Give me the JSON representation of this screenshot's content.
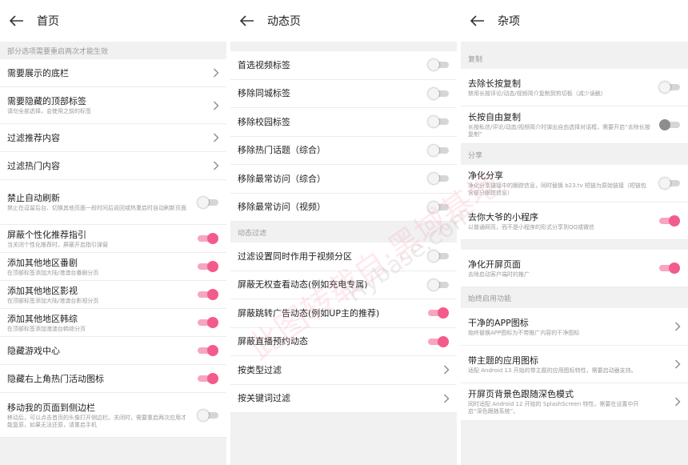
{
  "colors": {
    "accent": "#f25c8b",
    "accent_track": "#f8a5bf",
    "off_track": "#d6d6d6",
    "background": "#f1f1f1"
  },
  "icons": {
    "back": "arrow-left-icon",
    "chevron": "chevron-right-icon"
  },
  "panel1": {
    "title": "首页",
    "note": "部分选项需要重启两次才能生效",
    "items": [
      {
        "title": "需要展示的底栏",
        "type": "nav"
      },
      {
        "title": "需要隐藏的顶部标签",
        "desc": "请勿全部选择，会使用之前的标签",
        "type": "nav"
      },
      {
        "title": "过滤推荐内容",
        "type": "nav"
      },
      {
        "title": "过滤热门内容",
        "type": "nav"
      },
      {
        "title": "禁止自动刷新",
        "desc": "禁止在逗留后台、切换其他页面一段时间后返回或热重启时自动刷新页面",
        "type": "toggle",
        "on": false
      },
      {
        "title": "屏蔽个性化推荐指引",
        "desc": "当关闭个性化推荐时，屏蔽开启指引弹窗",
        "type": "toggle",
        "on": true
      },
      {
        "title": "添加其他地区番剧",
        "desc": "在顶部标签添加大陆/港澳台番剧分页",
        "type": "toggle",
        "on": true
      },
      {
        "title": "添加其他地区影视",
        "desc": "在顶部标签添加大陆/港澳台影视分页",
        "type": "toggle",
        "on": true
      },
      {
        "title": "添加其他地区韩综",
        "desc": "在顶部标签添加港澳台韩综分页",
        "type": "toggle",
        "on": true
      },
      {
        "title": "隐藏游戏中心",
        "type": "toggle",
        "on": true
      },
      {
        "title": "隐藏右上角热门活动图标",
        "type": "toggle",
        "on": true
      },
      {
        "title": "移动我的页面到侧边栏",
        "desc": "移动后，可以点击首页的头像打开侧边栏。关闭时，需要重启两次应用才能复原，如果无法还原，请重启手机",
        "type": "toggle",
        "on": false
      }
    ]
  },
  "panel2": {
    "title": "动态页",
    "groups": [
      {
        "header": "",
        "items": [
          {
            "title": "首选视频标签",
            "type": "toggle",
            "on": false
          },
          {
            "title": "移除同城标签",
            "type": "toggle",
            "on": false
          },
          {
            "title": "移除校园标签",
            "type": "toggle",
            "on": false
          },
          {
            "title": "移除热门话题（综合）",
            "type": "toggle",
            "on": false
          },
          {
            "title": "移除最常访问（综合）",
            "type": "toggle",
            "on": false
          },
          {
            "title": "移除最常访问（视频）",
            "type": "toggle",
            "on": false
          }
        ]
      },
      {
        "header": "动态过滤",
        "items": [
          {
            "title": "过滤设置同时作用于视频分区",
            "type": "toggle",
            "on": false
          },
          {
            "title": "屏蔽无权查看动态(例如充电专属)",
            "type": "toggle",
            "on": false
          },
          {
            "title": "屏蔽跳转广告动态(例如UP主的推荐)",
            "type": "toggle",
            "on": true
          },
          {
            "title": "屏蔽直播预约动态",
            "type": "toggle",
            "on": true
          },
          {
            "title": "按类型过滤",
            "type": "nav"
          },
          {
            "title": "按关键词过滤",
            "type": "nav"
          }
        ]
      }
    ]
  },
  "panel3": {
    "title": "杂项",
    "groups": [
      {
        "header": "复制",
        "items": [
          {
            "title": "去除长按复制",
            "desc": "禁用长按评论/动态/视频简介复制到剪切板（减少误触）",
            "type": "toggle",
            "on": false
          },
          {
            "title": "长按自由复制",
            "desc": "长按私信/评论/动态/视频简介时弹出自由选择对话框，需要开启“去除长按复制”",
            "type": "toggle",
            "on": false,
            "dim": true
          }
        ]
      },
      {
        "header": "分享",
        "items": [
          {
            "title": "净化分享",
            "desc": "净化分享链接中的跟踪信息，同时替换 b23.tv 短链为原始链接（短链包含部分跟踪信息）",
            "type": "toggle",
            "on": false
          },
          {
            "title": "去你大爷的小程序",
            "desc": "以普通网页，而不是小程序的形式分享到QQ或微信",
            "type": "toggle",
            "on": true
          }
        ]
      },
      {
        "header": "",
        "items": [
          {
            "title": "净化开屏页面",
            "desc": "去除启动客户端时的推广",
            "type": "toggle",
            "on": true
          }
        ]
      },
      {
        "header": "始终启用功能",
        "items": [
          {
            "title": "干净的APP图标",
            "desc": "始终替换APP图标为不带推广内容的干净图标",
            "type": "nav"
          },
          {
            "title": "带主题的应用图标",
            "desc": "适配 Android 13 开始的带主题的应用图标特性，需要启动器支持。",
            "type": "nav"
          },
          {
            "title": "开屏页背景色跟随深色模式",
            "desc": "同时适配 Android 12 开始的 SplashScreen 特性，需要在设置中开启“深色跟随系统”。",
            "type": "nav"
          }
        ]
      }
    ]
  },
  "watermark": {
    "main": "此图转载自·黑域基地",
    "sub": "Hybase.com"
  }
}
